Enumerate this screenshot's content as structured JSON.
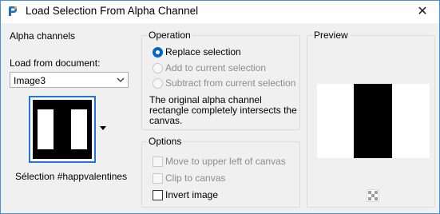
{
  "window": {
    "title": "Load Selection From Alpha Channel",
    "close_glyph": "✕"
  },
  "alpha_channels": {
    "group_label": "Alpha channels",
    "load_from_label": "Load from document:",
    "document_value": "Image3",
    "channel_caption": "Sélection #happvalentines"
  },
  "operation": {
    "group_label": "Operation",
    "options": [
      {
        "label": "Replace selection",
        "selected": true,
        "enabled": true
      },
      {
        "label": "Add to current selection",
        "selected": false,
        "enabled": false
      },
      {
        "label": "Subtract from current selection",
        "selected": false,
        "enabled": false
      }
    ],
    "info_text": "The original alpha channel rectangle completely intersects the canvas."
  },
  "options": {
    "group_label": "Options",
    "checkboxes": [
      {
        "label": "Move to upper left of canvas",
        "checked": false,
        "enabled": false
      },
      {
        "label": "Clip to canvas",
        "checked": false,
        "enabled": false
      },
      {
        "label": "Invert image",
        "checked": false,
        "enabled": true
      }
    ]
  },
  "preview": {
    "group_label": "Preview",
    "background_toggle_icon": "checkerboard-icon"
  },
  "colors": {
    "accent": "#0067c0",
    "thumbnail_border": "#1e78d2",
    "disabled_text": "#8c8c8c"
  }
}
